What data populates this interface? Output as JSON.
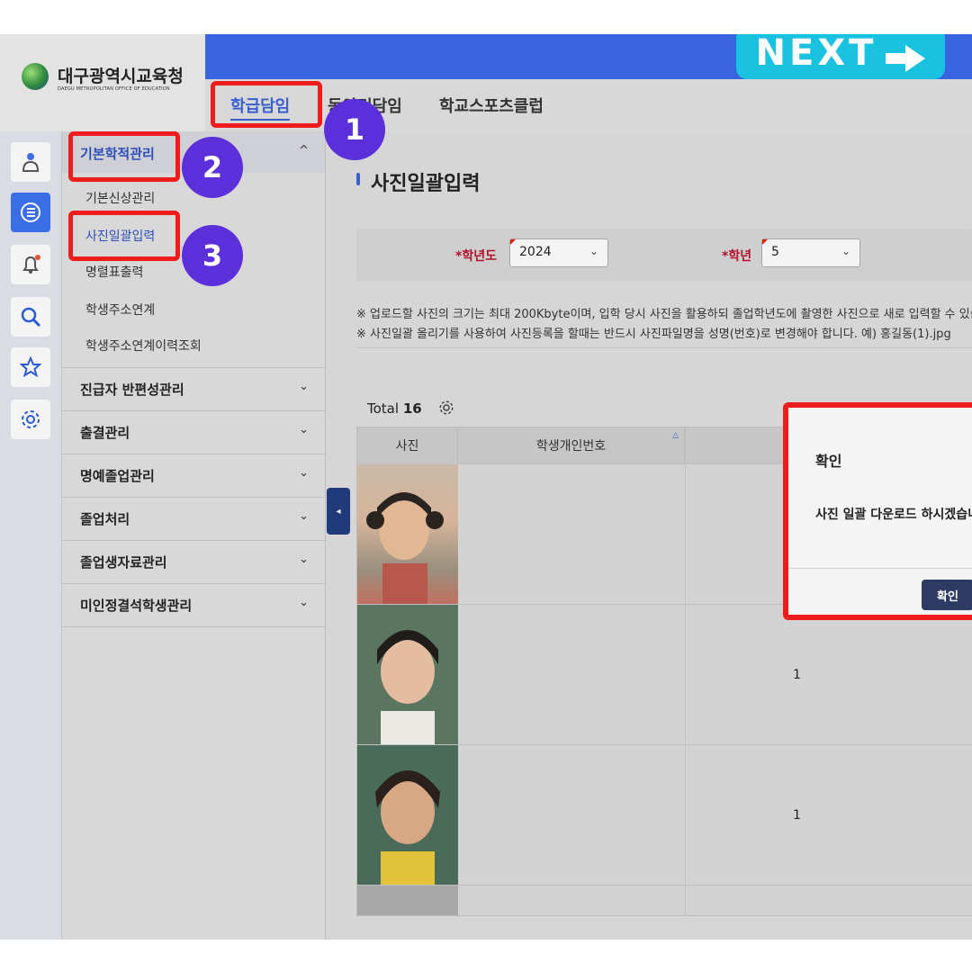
{
  "header": {
    "logo_title": "대구광역시교육청",
    "logo_sub": "DAEGU METROPOLITAN OFFICE OF EDUCATION",
    "next_label": "NEXT",
    "tabs": [
      {
        "label": "학급담임"
      },
      {
        "label": "동아리담임"
      },
      {
        "label": "학교스포츠클럽"
      }
    ]
  },
  "sidebar_icons": [
    "person-icon",
    "list-icon",
    "bell-icon",
    "search-icon",
    "star-icon",
    "gear-icon"
  ],
  "menu": {
    "group1": "기본학적관리",
    "subs": [
      "기본신상관리",
      "사진일괄입력",
      "명렬표출력",
      "학생주소연계",
      "학생주소연계이력조회"
    ],
    "groups": [
      "진급자 반편성관리",
      "출결관리",
      "명예졸업관리",
      "졸업처리",
      "졸업생자료관리",
      "미인정결석학생관리"
    ]
  },
  "page": {
    "title": "사진일괄입력",
    "filter_year_label": "*학년도",
    "filter_year_value": "2024",
    "filter_grade_label": "*학년",
    "filter_grade_value": "5",
    "note1": "※ 업로드할 사진의 크기는 최대 200Kbyte이며, 입학 당시 사진을 활용하되 졸업학년도에 촬영한 사진으로 새로 입력할 수 있습니다.",
    "note2": "※ 사진일괄 올리기를 사용하여 사진등록을 할때는 반드시 사진파일명을 성명(번호)로 변경해야 합니다. 예) 홍길동(1).jpg",
    "total_label": "Total",
    "total_count": "16"
  },
  "table": {
    "headers": [
      "사진",
      "학생개인번호"
    ],
    "rows": [
      {
        "num": ""
      },
      {
        "num": "1"
      },
      {
        "num": "1"
      }
    ]
  },
  "dialog": {
    "title": "확인",
    "message": "사진 일괄 다운로드 하시겠습니까?",
    "confirm": "확인"
  },
  "annotations": {
    "step1": "1",
    "step2": "2",
    "step3": "3"
  },
  "colors": {
    "accent": "#3a63e0",
    "badge": "#5b2fd9",
    "highlight": "#ee1c1c",
    "next": "#19c2e0"
  }
}
